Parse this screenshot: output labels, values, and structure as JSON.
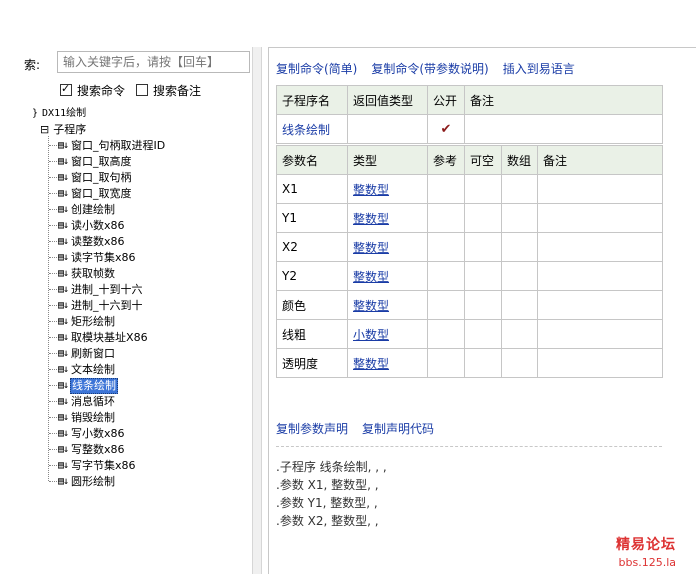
{
  "search": {
    "label": "索:",
    "placeholder": "输入关键字后，请按【回车】",
    "options": [
      {
        "label": "搜索命令",
        "checked": true
      },
      {
        "label": "搜索备注",
        "checked": false
      }
    ]
  },
  "tree": {
    "root": "DX11绘制",
    "group": "子程序",
    "items": [
      "窗口_句柄取进程ID",
      "窗口_取高度",
      "窗口_取句柄",
      "窗口_取宽度",
      "创建绘制",
      "读小数x86",
      "读整数x86",
      "读字节集x86",
      "获取帧数",
      "进制_十到十六",
      "进制_十六到十",
      "矩形绘制",
      "取模块基址X86",
      "刷新窗口",
      "文本绘制",
      "线条绘制",
      "消息循环",
      "销毁绘制",
      "写小数x86",
      "写整数x86",
      "写字节集x86",
      "圆形绘制"
    ],
    "selected": "线条绘制"
  },
  "top_links": [
    "复制命令(简单)",
    "复制命令(带参数说明)",
    "插入到易语言"
  ],
  "sub_table": {
    "headers": [
      "子程序名",
      "返回值类型",
      "公开",
      "备注"
    ],
    "row": {
      "name": "线条绘制",
      "return_type": "",
      "public_mark": "✔",
      "note": ""
    }
  },
  "param_table": {
    "headers": [
      "参数名",
      "类型",
      "参考",
      "可空",
      "数组",
      "备注"
    ],
    "rows": [
      {
        "name": "X1",
        "type": "整数型"
      },
      {
        "name": "Y1",
        "type": "整数型"
      },
      {
        "name": "X2",
        "type": "整数型"
      },
      {
        "name": "Y2",
        "type": "整数型"
      },
      {
        "name": "颜色",
        "type": "整数型"
      },
      {
        "name": "线粗",
        "type": "小数型"
      },
      {
        "name": "透明度",
        "type": "整数型"
      }
    ]
  },
  "bottom_links": [
    "复制参数声明",
    "复制声明代码"
  ],
  "declaration": [
    ".子程序 线条绘制, , ,",
    ".参数 X1, 整数型, ,",
    ".参数 Y1, 整数型, ,",
    ".参数 X2, 整数型, ,"
  ],
  "watermark": {
    "line1": "精易论坛",
    "line2": "bbs.125.la"
  }
}
